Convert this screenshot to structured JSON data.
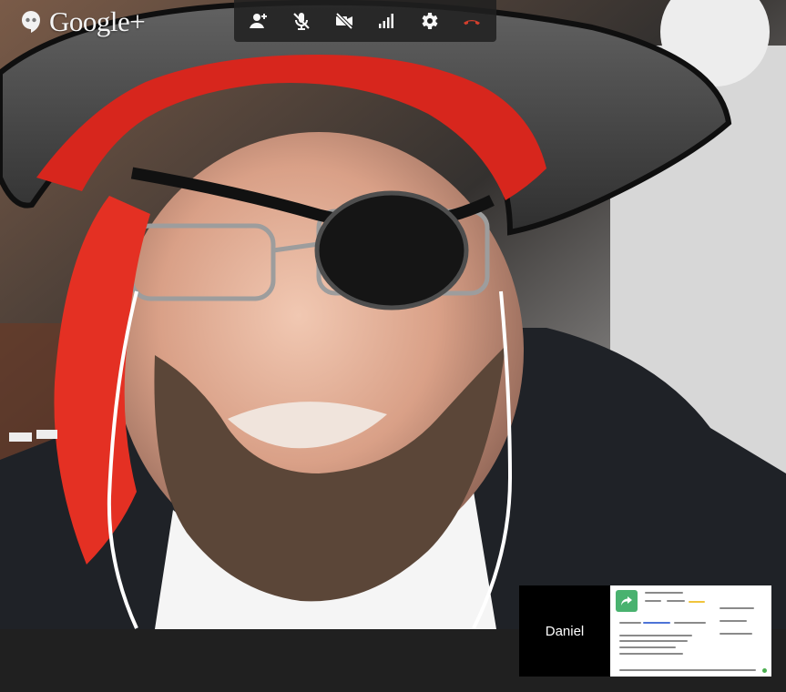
{
  "app": {
    "brand_text": "Google+"
  },
  "toolbar": {
    "items": [
      {
        "name": "add-person-button",
        "icon": "person-add-icon"
      },
      {
        "name": "mute-microphone-button",
        "icon": "microphone-off-icon"
      },
      {
        "name": "turn-off-camera-button",
        "icon": "video-off-icon"
      },
      {
        "name": "bandwidth-button",
        "icon": "signal-icon"
      },
      {
        "name": "settings-button",
        "icon": "gear-icon"
      },
      {
        "name": "end-call-button",
        "icon": "phone-hangup-icon"
      }
    ]
  },
  "participants": [
    {
      "name": "Daniel"
    }
  ],
  "colors": {
    "toolbar_background": "#202020",
    "hangup_red": "#d33f2d",
    "screen_share_green": "#49b26f"
  }
}
